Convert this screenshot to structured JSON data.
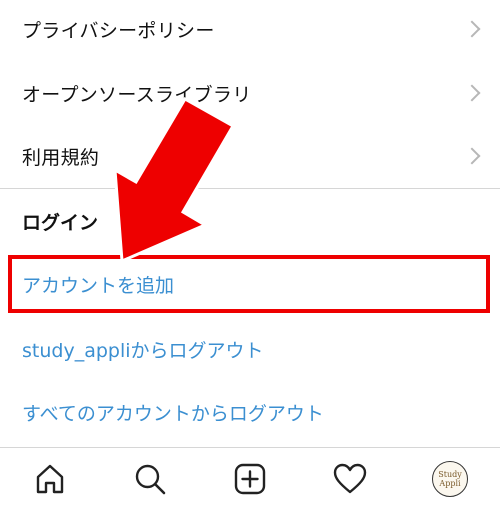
{
  "menu": {
    "items": [
      {
        "label": "プライバシーポリシー"
      },
      {
        "label": "オープンソースライブラリ"
      },
      {
        "label": "利用規約"
      }
    ]
  },
  "login_section": {
    "title": "ログイン",
    "add_account": "アカウントを追加",
    "logout_user": "study_appliからログアウト",
    "logout_all": "すべてのアカウントからログアウト"
  },
  "tab_bar": {
    "tabs": [
      {
        "icon": "home-icon"
      },
      {
        "icon": "search-icon"
      },
      {
        "icon": "add-post-icon"
      },
      {
        "icon": "heart-icon"
      },
      {
        "icon": "profile-avatar"
      }
    ],
    "avatar_text_line1": "Study",
    "avatar_text_line2": "Appli"
  },
  "colors": {
    "link": "#3b8fd1",
    "annotation_red": "#ee0000"
  }
}
